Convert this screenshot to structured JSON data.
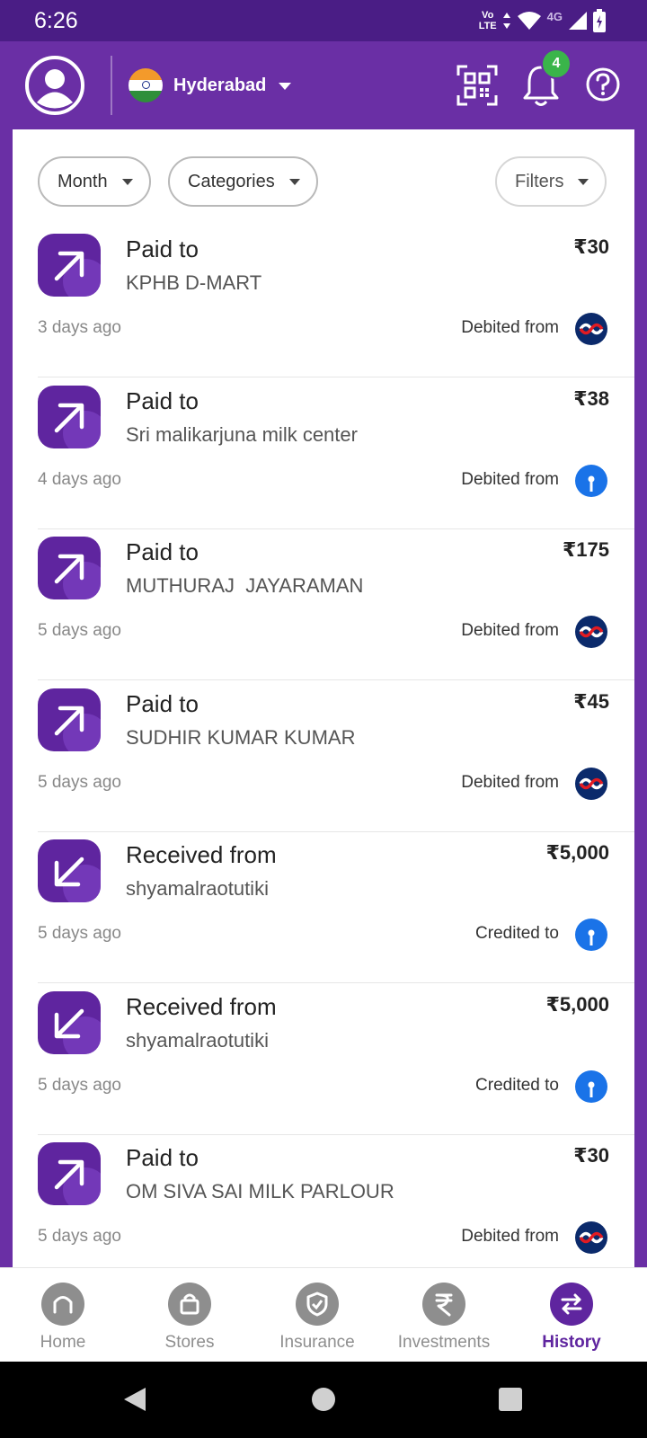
{
  "status_bar": {
    "time": "6:26",
    "volte_top": "Vo",
    "volte_bottom": "LTE",
    "network": "4G"
  },
  "header": {
    "city": "Hyderabad",
    "notification_count": "4",
    "icons": {
      "profile": "profile-icon",
      "qr": "qr-scan-icon",
      "bell": "bell-icon",
      "help": "help-icon"
    }
  },
  "filters": [
    {
      "label": "Month"
    },
    {
      "label": "Categories"
    },
    {
      "label": "Filters"
    }
  ],
  "transactions": [
    {
      "type": "Paid to",
      "party": "KPHB D-MART",
      "amount": "₹30",
      "time": "3 days ago",
      "account_label": "Debited from",
      "direction": "out",
      "bank": "kotak"
    },
    {
      "type": "Paid to",
      "party": "Sri malikarjuna milk center",
      "amount": "₹38",
      "time": "4 days ago",
      "account_label": "Debited from",
      "direction": "out",
      "bank": "sbi"
    },
    {
      "type": "Paid to",
      "party": "MUTHURAJ  JAYARAMAN",
      "amount": "₹175",
      "time": "5 days ago",
      "account_label": "Debited from",
      "direction": "out",
      "bank": "kotak"
    },
    {
      "type": "Paid to",
      "party": "SUDHIR KUMAR KUMAR",
      "amount": "₹45",
      "time": "5 days ago",
      "account_label": "Debited from",
      "direction": "out",
      "bank": "kotak"
    },
    {
      "type": "Received from",
      "party": "shyamalraotutiki",
      "amount": "₹5,000",
      "time": "5 days ago",
      "account_label": "Credited to",
      "direction": "in",
      "bank": "sbi"
    },
    {
      "type": "Received from",
      "party": "shyamalraotutiki",
      "amount": "₹5,000",
      "time": "5 days ago",
      "account_label": "Credited to",
      "direction": "in",
      "bank": "sbi"
    },
    {
      "type": "Paid to",
      "party": "OM SIVA SAI MILK PARLOUR",
      "amount": "₹30",
      "time": "5 days ago",
      "account_label": "Debited from",
      "direction": "out",
      "bank": "kotak"
    }
  ],
  "bottom_nav": [
    {
      "label": "Home",
      "icon": "home-icon",
      "active": false
    },
    {
      "label": "Stores",
      "icon": "stores-icon",
      "active": false
    },
    {
      "label": "Insurance",
      "icon": "insurance-icon",
      "active": false
    },
    {
      "label": "Investments",
      "icon": "investments-icon",
      "active": false
    },
    {
      "label": "History",
      "icon": "history-icon",
      "active": true
    }
  ],
  "colors": {
    "brand": "#5f259f",
    "header": "#6a2fa5",
    "status_bar": "#4a1d85",
    "badge": "#3ab54a",
    "sbi_blue": "#1a73e8",
    "kotak_navy": "#0b2a6b",
    "kotak_red": "#e21b22"
  }
}
